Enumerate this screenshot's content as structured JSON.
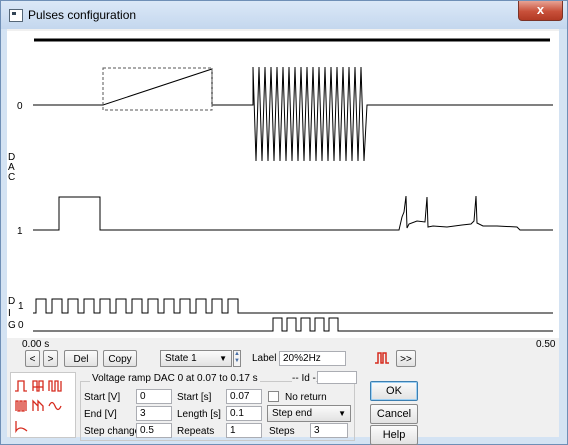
{
  "window": {
    "title": "Pulses configuration",
    "close_glyph": "x"
  },
  "plot": {
    "dac_axis_label": [
      "D",
      "A",
      "C"
    ],
    "dig_axis_label": [
      "D",
      "I",
      "G"
    ],
    "dac_channel_labels": [
      "0",
      "1"
    ],
    "dig_channel_labels": [
      "1",
      "0"
    ],
    "time_start": "0.00 s",
    "time_end": "0.50"
  },
  "toolbar": {
    "prev_label": "<",
    "next_label": ">",
    "del_label": "Del",
    "copy_label": "Copy",
    "state_value": "State 1",
    "label_caption": "Label",
    "label_value": "20%2Hz",
    "more_label": ">>",
    "pulse_icon_color": "#d62b1e"
  },
  "ramp": {
    "group_title": "Voltage ramp DAC 0 at 0.07 to 0.17 s",
    "id_caption": "-- Id -",
    "id_value": "",
    "start_v_caption": "Start [V]",
    "start_v_value": "0",
    "end_v_caption": "End [V]",
    "end_v_value": "3",
    "step_change_caption": "Step change",
    "step_change_value": "0.5",
    "start_s_caption": "Start [s]",
    "start_s_value": "0.07",
    "length_caption": "Length [s]",
    "length_value": "0.1",
    "repeats_caption": "Repeats",
    "repeats_value": "1",
    "no_return_caption": "No return",
    "step_mode_value": "Step end",
    "steps_caption": "Steps",
    "steps_value": "3"
  },
  "dialog": {
    "ok_label": "OK",
    "cancel_label": "Cancel",
    "help_label": "Help"
  },
  "waveform_icons": [
    "square-pulse-icon",
    "pulse-train-icon",
    "double-pulse-icon",
    "burst-icon",
    "ramp-pulse-icon",
    "sine-icon",
    "exponential-icon"
  ]
}
